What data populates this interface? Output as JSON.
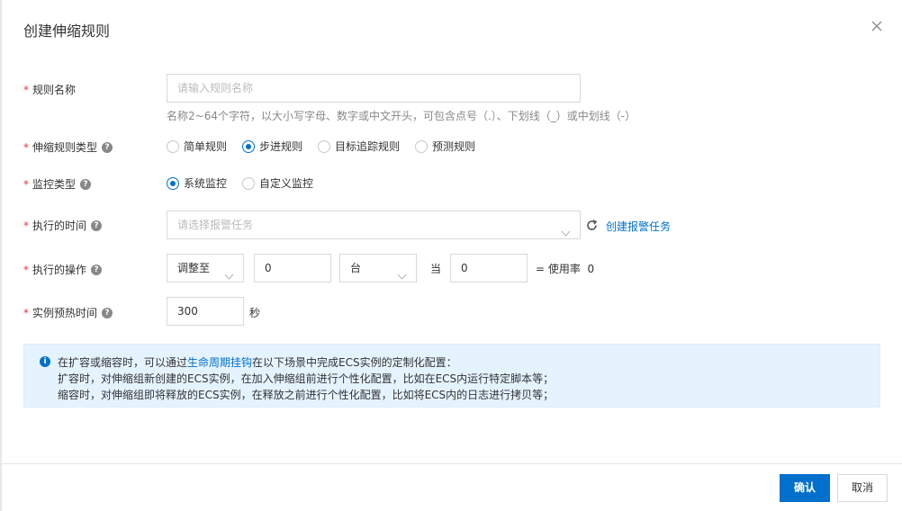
{
  "dialog": {
    "title": "创建伸缩规则",
    "close_icon": "close-icon"
  },
  "rule_name": {
    "label": "规则名称",
    "placeholder": "请输入规则名称",
    "hint": "名称2~64个字符，以大小写字母、数字或中文开头，可包含点号（.）、下划线（_）或中划线（-）"
  },
  "rule_type": {
    "label": "伸缩规则类型",
    "options": [
      "简单规则",
      "步进规则",
      "目标追踪规则",
      "预测规则"
    ],
    "selected": "步进规则"
  },
  "monitor_type": {
    "label": "监控类型",
    "options": [
      "系统监控",
      "自定义监控"
    ],
    "selected": "系统监控"
  },
  "exec_time": {
    "label": "执行的时间",
    "placeholder": "请选择报警任务",
    "refresh_icon": "refresh-icon",
    "create_link": "创建报警任务"
  },
  "exec_action": {
    "label": "执行的操作",
    "action_select": "调整至",
    "count_value": "0",
    "unit_select": "台",
    "when_label": "当",
    "when_value": "0",
    "suffix": "= 使用率  0"
  },
  "warmup": {
    "label": "实例预热时间",
    "value": "300",
    "unit": "秒"
  },
  "info": {
    "line1_prefix": "在扩容或缩容时，可以通过",
    "line1_link": "生命周期挂钩",
    "line1_suffix": "在以下场景中完成ECS实例的定制化配置：",
    "line2": "扩容时，对伸缩组新创建的ECS实例，在加入伸缩组前进行个性化配置，比如在ECS内运行特定脚本等；",
    "line3": "缩容时，对伸缩组即将释放的ECS实例，在释放之前进行个性化配置，比如将ECS内的日志进行拷贝等；"
  },
  "footer": {
    "confirm": "确认",
    "cancel": "取消"
  },
  "colors": {
    "primary": "#0070cc",
    "required": "#e4393c",
    "info_bg": "#e5f3ff"
  }
}
